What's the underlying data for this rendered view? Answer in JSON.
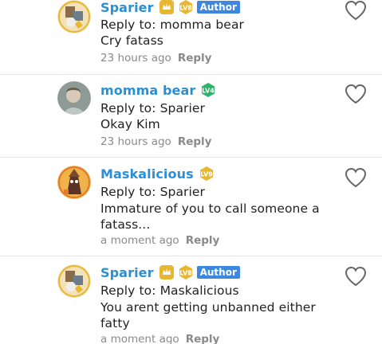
{
  "comments": [
    {
      "username": "Sparier",
      "level": "LV8",
      "author_label": "Author",
      "reply_to": "Reply to: momma bear",
      "body": [
        "Cry fatass"
      ],
      "time": "23 hours ago",
      "reply_label": "Reply"
    },
    {
      "username": "momma bear",
      "level": "LV4",
      "reply_to": "Reply to: Sparier",
      "body": [
        "Okay Kim"
      ],
      "time": "23 hours ago",
      "reply_label": "Reply"
    },
    {
      "username": "Maskalicious",
      "level": "LV9",
      "reply_to": "Reply to: Sparier",
      "body": [
        "Immature of you to call someone a",
        "fatass..."
      ],
      "time": "a moment ago",
      "reply_label": "Reply"
    },
    {
      "username": "Sparier",
      "level": "LV8",
      "author_label": "Author",
      "reply_to": "Reply to: Maskalicious",
      "body": [
        "You arent getting unbanned either",
        "fatty"
      ],
      "time": "a moment ago",
      "reply_label": "Reply"
    }
  ],
  "colors": {
    "username": "#2a8fd6",
    "author_badge": "#3d87e0",
    "meta_text": "#8a8a8a",
    "gold_badge": "#e7b731",
    "green_badge": "#2fb36a"
  }
}
